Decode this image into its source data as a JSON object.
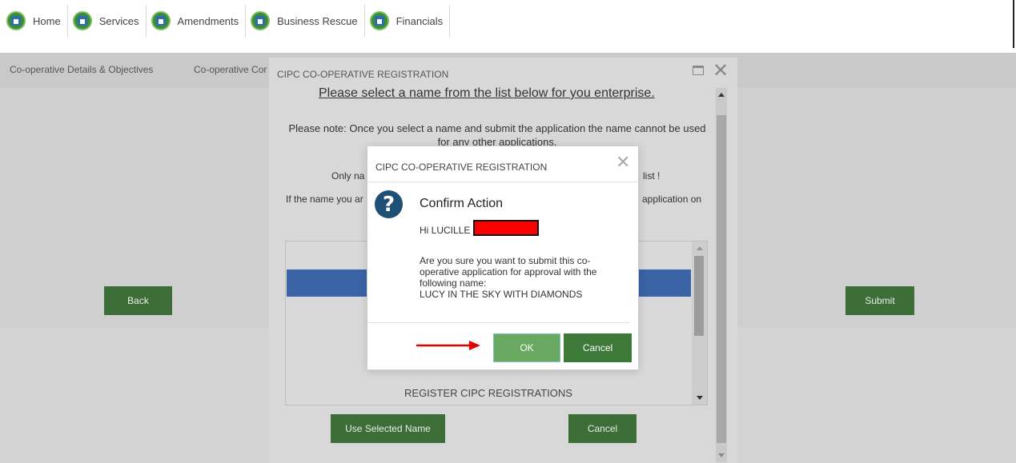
{
  "nav": {
    "items": [
      {
        "label": "Home",
        "icon": "home-icon"
      },
      {
        "label": "Services",
        "icon": "services-icon"
      },
      {
        "label": "Amendments",
        "icon": "amendments-icon"
      },
      {
        "label": "Business Rescue",
        "icon": "business-rescue-icon"
      },
      {
        "label": "Financials",
        "icon": "financials-icon"
      }
    ]
  },
  "page": {
    "tabs": [
      "Co-operative Details & Objectives",
      "Co-operative Cor"
    ],
    "back_label": "Back",
    "submit_label": "Submit"
  },
  "outer_modal": {
    "title": "CIPC CO-OPERATIVE REGISTRATION",
    "heading": "Please select a name from the list below for you enterprise.",
    "note": "Please note: Once you select a name and submit the application the name cannot be used for any other applications.",
    "line_only_left": "Only na",
    "line_only_right": "list !",
    "line_if_left": "If the name you ar",
    "line_if_right": "application on",
    "list_bottom_item": "REGISTER CIPC REGISTRATIONS",
    "use_selected_label": "Use Selected Name",
    "cancel_label": "Cancel"
  },
  "dialog": {
    "title": "CIPC CO-OPERATIVE REGISTRATION",
    "heading": "Confirm Action",
    "greeting": "Hi LUCILLE RA",
    "message": "Are you sure you want to submit this co-operative application for approval with the following name:",
    "name": "LUCY IN THE SKY WITH DIAMONDS",
    "ok_label": "OK",
    "cancel_label": "Cancel"
  },
  "colors": {
    "green_button": "#3d6e37",
    "ok_button": "#6aa962",
    "selected_row": "#3a64a5",
    "question_icon": "#1e4f75",
    "redaction": "#ff0000",
    "annotation_arrow": "#e00000"
  }
}
